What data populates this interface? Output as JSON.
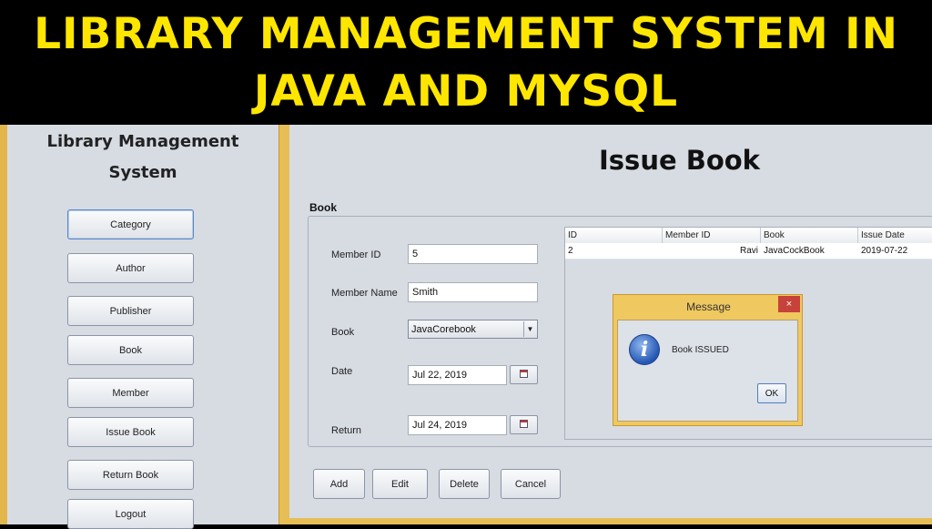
{
  "banner": {
    "line1": "LIBRARY MANAGEMENT SYSTEM IN",
    "line2": "JAVA AND MYSQL",
    "color": "#ffe600"
  },
  "sidebar": {
    "title_line1": "Library Management",
    "title_line2": "System",
    "items": [
      {
        "label": "Category"
      },
      {
        "label": "Author"
      },
      {
        "label": "Publisher"
      },
      {
        "label": "Book"
      },
      {
        "label": "Member"
      },
      {
        "label": "Issue Book"
      },
      {
        "label": "Return Book"
      },
      {
        "label": "Logout"
      }
    ]
  },
  "main": {
    "title": "Issue Book",
    "group_label": "Book",
    "form": {
      "member_id_label": "Member ID",
      "member_id_value": "5",
      "member_name_label": "Member Name",
      "member_name_value": "Smith",
      "book_label": "Book",
      "book_value": "JavaCorebook",
      "date_label": "Date",
      "date_value": "Jul 22, 2019",
      "return_label": "Return",
      "return_value": "Jul 24, 2019"
    },
    "table": {
      "columns": [
        "ID",
        "Member ID",
        "Book",
        "Issue Date"
      ],
      "rows": [
        [
          "2",
          "Ravi",
          "JavaCockBook",
          "2019-07-22"
        ]
      ]
    },
    "actions": {
      "add": "Add",
      "edit": "Edit",
      "delete": "Delete",
      "cancel": "Cancel"
    }
  },
  "dialog": {
    "title": "Message",
    "close": "×",
    "message": "Book ISSUED",
    "ok": "OK",
    "icon": "info-icon"
  }
}
